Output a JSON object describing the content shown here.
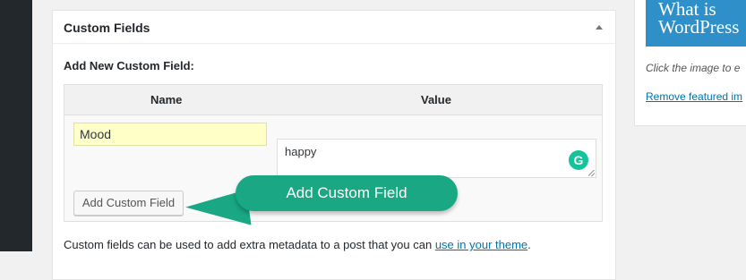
{
  "metabox": {
    "title": "Custom Fields",
    "add_new_label": "Add New Custom Field:",
    "columns": {
      "name": "Name",
      "value": "Value"
    },
    "name_input_value": "Mood",
    "value_textarea_value": "happy",
    "add_button_label": "Add Custom Field",
    "help_text": "Custom fields can be used to add extra metadata to a post that you can ",
    "help_link": "use in your theme",
    "help_text_end": "."
  },
  "featured_image": {
    "image_text": "What is WordPress",
    "caption": "Click the image to e",
    "remove_link": "Remove featured im"
  },
  "callout": {
    "text": "Add Custom Field"
  },
  "icons": {
    "toggle": "arrow-up-icon",
    "grammarly": "grammarly-icon",
    "resize": "resize-handle-icon"
  },
  "colors": {
    "admin_sidebar": "#23282d",
    "name_input_bg": "#ffffc8",
    "link": "#0073aa",
    "callout": "#19a784",
    "featured_bg": "#2f8fc9",
    "grammarly": "#15c39a"
  }
}
